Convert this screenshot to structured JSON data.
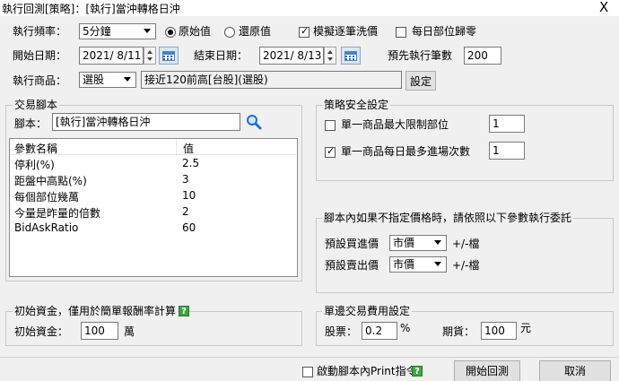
{
  "window": {
    "title": "執行回測[策略]：[執行]當沖轉格日沖",
    "close_glyph": "X"
  },
  "top": {
    "freq_label": "執行頻率：",
    "freq_value": "5分鐘",
    "radio_original": "原始值",
    "radio_restored": "還原值",
    "check_simulate": "模擬逐筆洗價",
    "check_reset_daily": "每日部位歸零",
    "start_label": "開始日期：",
    "start_date": "2021/ 8/11",
    "end_label": "結束日期：",
    "end_date": "2021/ 8/13",
    "prerun_label": "預先執行筆數",
    "prerun_value": "200",
    "product_label": "執行商品：",
    "product_select": "選股",
    "product_value": "接近120前高[台股](選股)",
    "setting_button": "設定"
  },
  "script": {
    "group_title": "交易腳本",
    "name_label": "腳本：",
    "name_value": "[執行]當沖轉格日沖",
    "columns": [
      "參數名稱",
      "值"
    ],
    "rows": [
      [
        "停利(%)",
        "2.5"
      ],
      [
        "距盤中高點(%)",
        "3"
      ],
      [
        "每個部位幾萬",
        "10"
      ],
      [
        "今量是昨量的倍數",
        "2"
      ],
      [
        "BidAskRatio",
        "60"
      ]
    ]
  },
  "safety": {
    "group_title": "策略安全設定",
    "max_position_label": "單一商品最大限制部位",
    "max_position_value": "1",
    "max_entries_label": "單一商品每日最多進場次數",
    "max_entries_value": "1"
  },
  "order": {
    "group_title": "腳本內如果不指定價格時，請依照以下參數執行委託",
    "buy_label": "預設買進價",
    "buy_value": "市價",
    "buy_suffix": "+/-檔",
    "sell_label": "預設賣出價",
    "sell_value": "市價",
    "sell_suffix": "+/-檔"
  },
  "capital": {
    "group_title": "初始資金，僅用於簡單報酬率計算",
    "label": "初始資金：",
    "value": "100",
    "unit": "萬"
  },
  "fee": {
    "group_title": "單邊交易費用設定",
    "stock_label": "股票：",
    "stock_value": "0.2",
    "stock_unit": "%",
    "futures_label": "期貨：",
    "futures_value": "100",
    "futures_unit": "元"
  },
  "footer": {
    "print_check_label": "啟動腳本內Print指令",
    "help_glyph": "?",
    "start_button": "開始回測",
    "cancel_button": "取消"
  }
}
